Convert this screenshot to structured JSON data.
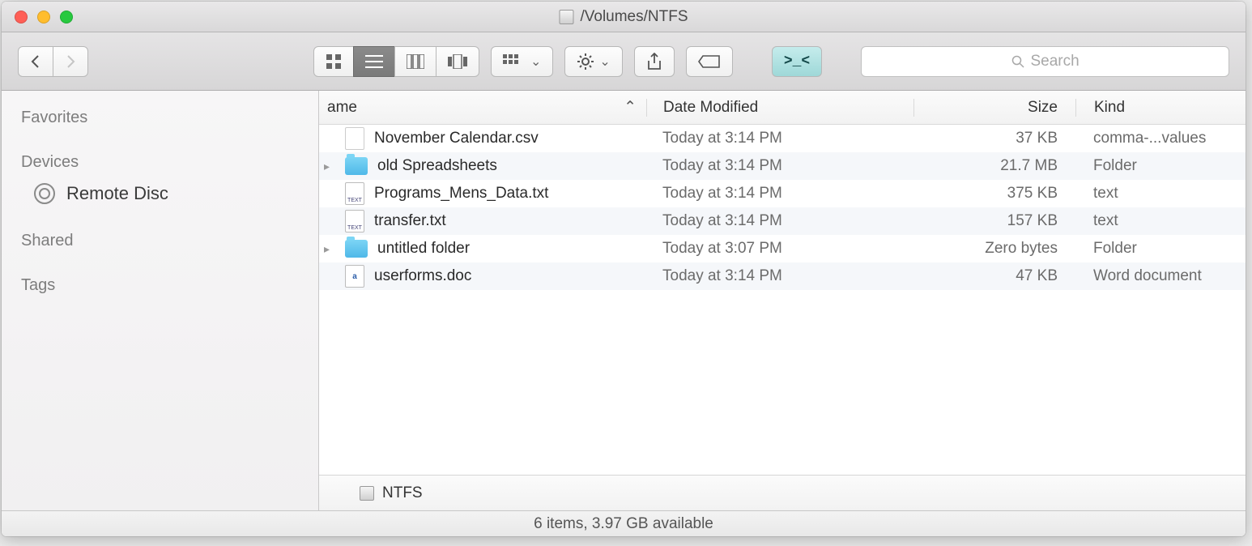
{
  "title": "/Volumes/NTFS",
  "search_placeholder": "Search",
  "sidebar": {
    "favorites_label": "Favorites",
    "devices_label": "Devices",
    "shared_label": "Shared",
    "tags_label": "Tags",
    "remote_disc": "Remote Disc"
  },
  "columns": {
    "name": "ame",
    "date": "Date Modified",
    "size": "Size",
    "kind": "Kind"
  },
  "files": [
    {
      "disclosure": "",
      "icon": "file",
      "name": "November Calendar.csv",
      "date": "Today at 3:14 PM",
      "size": "37 KB",
      "kind": "comma-...values"
    },
    {
      "disclosure": "▸",
      "icon": "folder",
      "name": "old Spreadsheets",
      "date": "Today at 3:14 PM",
      "size": "21.7 MB",
      "kind": "Folder"
    },
    {
      "disclosure": "",
      "icon": "text",
      "name": "Programs_Mens_Data.txt",
      "date": "Today at 3:14 PM",
      "size": "375 KB",
      "kind": "text"
    },
    {
      "disclosure": "",
      "icon": "text",
      "name": "transfer.txt",
      "date": "Today at 3:14 PM",
      "size": "157 KB",
      "kind": "text"
    },
    {
      "disclosure": "▸",
      "icon": "folder",
      "name": "untitled folder",
      "date": "Today at 3:07 PM",
      "size": "Zero bytes",
      "kind": "Folder"
    },
    {
      "disclosure": "",
      "icon": "doc",
      "name": "userforms.doc",
      "date": "Today at 3:14 PM",
      "size": "47 KB",
      "kind": "Word document"
    }
  ],
  "pathbar": {
    "name": "NTFS"
  },
  "status": "6 items, 3.97 GB available"
}
